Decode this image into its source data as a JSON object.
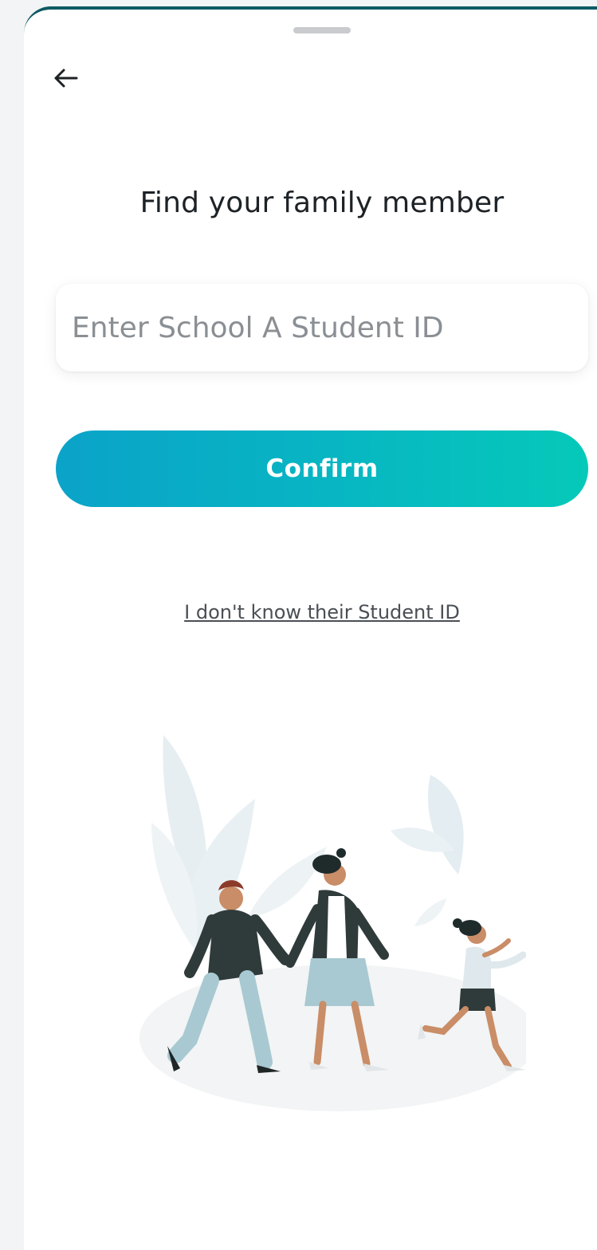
{
  "screen": {
    "title": "Find your family member"
  },
  "form": {
    "student_id_value": "",
    "student_id_placeholder": "Enter School A Student ID",
    "confirm_label": "Confirm"
  },
  "links": {
    "unknown_id": "I don't know their Student ID"
  },
  "icons": {
    "back": "arrow-left-icon"
  },
  "colors": {
    "header_accent": "#0c5a63",
    "button_gradient_start": "#0ba3c9",
    "button_gradient_end": "#06c9b9",
    "background": "#f3f4f5"
  }
}
